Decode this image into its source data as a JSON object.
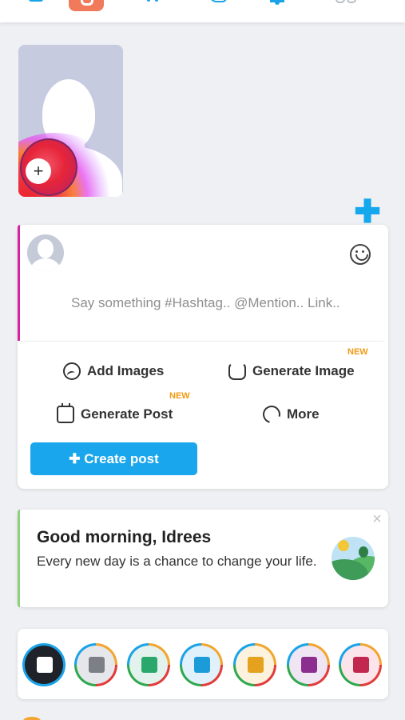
{
  "top_nav": {
    "items": [
      "home-icon",
      "feed-icon",
      "apps-icon",
      "messages-icon",
      "notifications-icon",
      "more-icon"
    ],
    "active_color": "#f07a5a",
    "accent_color": "#1aa3e8"
  },
  "story": {
    "add_symbol": "+"
  },
  "fab": {
    "symbol": "✚"
  },
  "composer": {
    "placeholder": "Say something #Hashtag.. @Mention.. Link..",
    "actions": [
      {
        "label": "Add Images",
        "icon": "image-icon",
        "badge": ""
      },
      {
        "label": "Generate Image",
        "icon": "generate-image-icon",
        "badge": "NEW"
      },
      {
        "label": "Generate Post",
        "icon": "calendar-icon",
        "badge": "NEW"
      },
      {
        "label": "More",
        "icon": "more-icon",
        "badge": ""
      }
    ],
    "create_button": "✚ Create post",
    "accent_color": "#d4259e"
  },
  "greeting": {
    "title": "Good morning, Idrees",
    "message": "Every new day is a chance to change your life.",
    "close": "×",
    "accent_color": "#8fd07d"
  },
  "categories": [
    {
      "name": "news-feed-icon",
      "bg": "#1f2329",
      "glyph": "#ffffff"
    },
    {
      "name": "blogs-icon",
      "bg": "#e6e7ea",
      "glyph": "#7d7f86"
    },
    {
      "name": "photos-icon",
      "bg": "#e3f2ec",
      "glyph": "#2aa86b"
    },
    {
      "name": "videos-icon",
      "bg": "#e1f1fb",
      "glyph": "#1b9bd8"
    },
    {
      "name": "sounds-icon",
      "bg": "#fdf2dd",
      "glyph": "#e4a21f"
    },
    {
      "name": "files-icon",
      "bg": "#efe5f3",
      "glyph": "#8b2e8f"
    },
    {
      "name": "maps-icon",
      "bg": "#fbe4ea",
      "glyph": "#c1274f"
    }
  ]
}
